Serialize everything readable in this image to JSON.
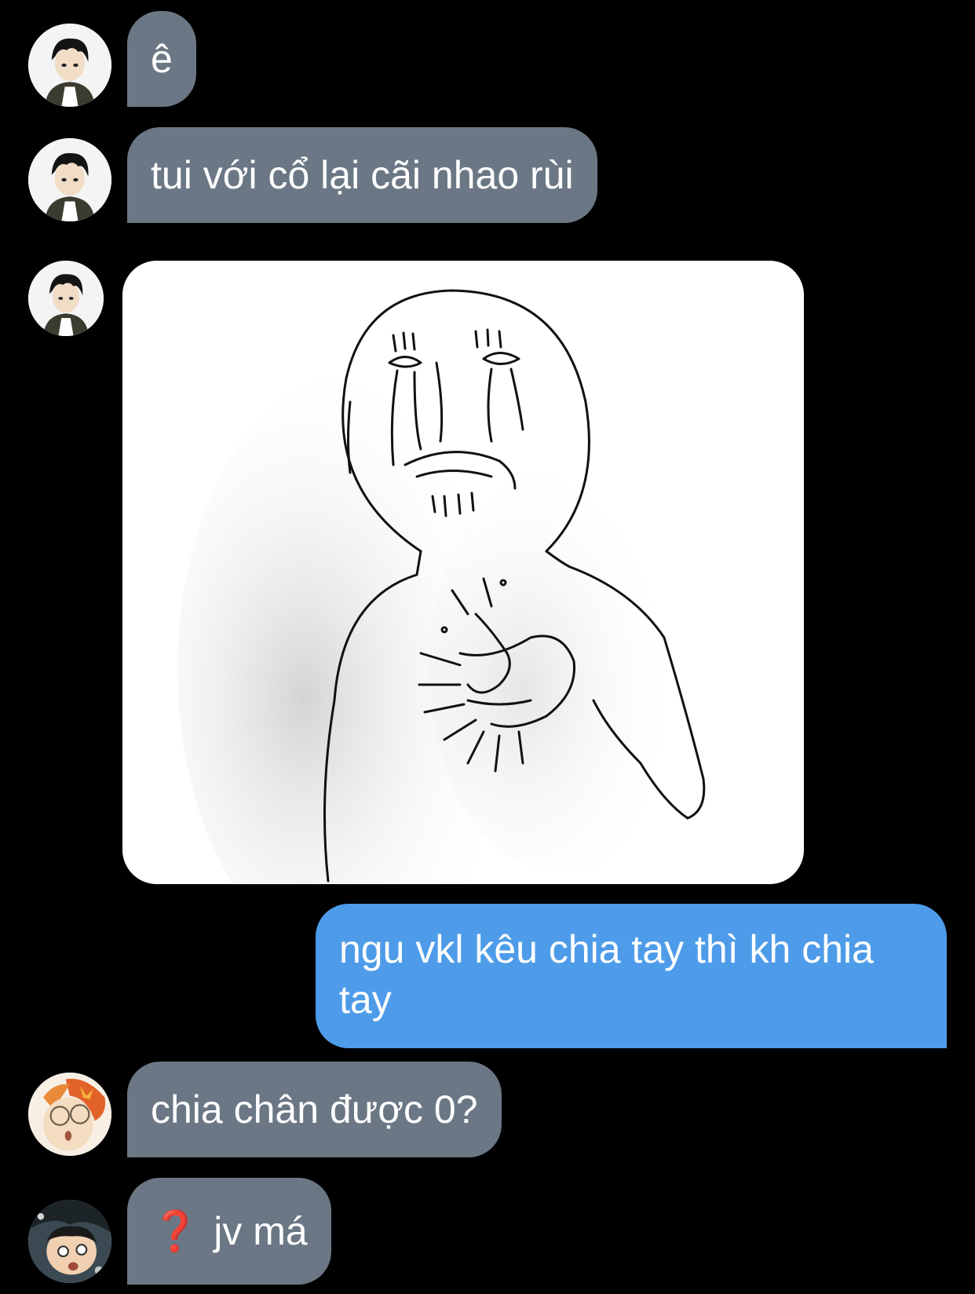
{
  "messages": [
    {
      "sender": "incoming",
      "avatar": "akaashi-avatar",
      "text": "ê"
    },
    {
      "sender": "incoming",
      "avatar": "akaashi-avatar",
      "text": "tui với cổ lại cãi nhao rùi"
    },
    {
      "sender": "incoming",
      "avatar": "akaashi-avatar",
      "image": "crying-meme-drawing"
    },
    {
      "sender": "outgoing",
      "text": "ngu vkl kêu chia tay thì kh chia tay"
    },
    {
      "sender": "incoming",
      "avatar": "hinata-avatar",
      "text": "chia chân được 0?"
    },
    {
      "sender": "incoming",
      "avatar": "nishinoya-avatar",
      "emoji": "❓",
      "text": "jv má"
    }
  ],
  "colors": {
    "background": "#000000",
    "incoming_bubble": "#6b7785",
    "outgoing_bubble": "#4e9ce9",
    "text": "#ffffff"
  }
}
